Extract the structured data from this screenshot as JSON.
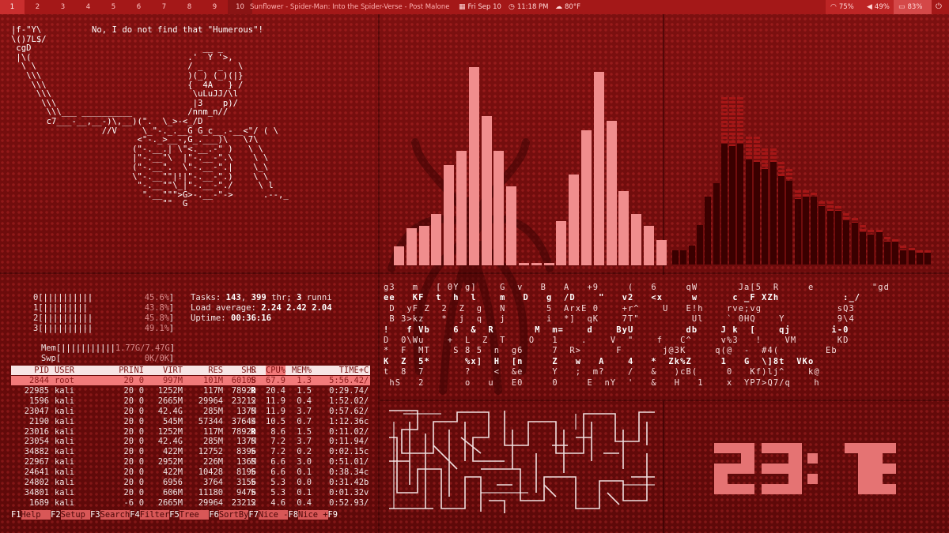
{
  "topbar": {
    "workspaces": [
      "1",
      "2",
      "3",
      "4",
      "5",
      "6",
      "7",
      "8",
      "9",
      "10"
    ],
    "active_workspace": "1",
    "now_playing": "Sunflower - Spider-Man: Into the Spider-Verse - Post Malone",
    "date": "Fri Sep 10",
    "time": "11:18 PM",
    "weather": "80°F",
    "wifi": "75%",
    "volume": "49%",
    "battery": "83%",
    "icons": [
      "calendar-icon",
      "clock-icon",
      "cloud-icon",
      "wifi-icon",
      "volume-icon",
      "battery-icon",
      "power-icon"
    ]
  },
  "ascii": {
    "lines": [
      "|f-\"Y\\          No, I do not find that \"Humerous\"!",
      "\\()7L$/",
      " cgD                                  __ _",
      " |\\(                               .'  Y '>,",
      "  \\ \\                              / _   _   \\",
      "   \\\\\\                             )(_) (_)(|}",
      "    \\\\\\                            {  4A   } /",
      "     \\\\\\                            \\uLuJJ/\\l",
      "      \\\\\\                           |3    p)/",
      "       \\\\\\___ __________           /nnm_n//",
      "       c7___-__,__-)\\,__)(\".  \\_>-<_/D",
      "                  //V     \\_\"-._.__G G_c__.-__<\"/ ( \\",
      "                         <\"-._>__-,G_.___)\\   \\7\\",
      "                        (\"-.__.| \\\"<.__.-\" )   \\ \\",
      "                        |\"-.__\"\\  |\"-.__-\".\\    \\ \\",
      "                        (\"-.__\".  \\\"-.__-\".|    \\_\\",
      "                        \\\"-.__\"\"|!|\"-.__-\".)    \\ \\",
      "                         \"-.__\"\"\\_|\"-.__-\"./     \\ l",
      "                          \".__\"\"\">G>-.__-\"->      .--,_",
      "                              \"\"  G"
    ]
  },
  "htop": {
    "cpus": [
      {
        "label": "0",
        "bar": "||||||||||",
        "pct": "45.6%",
        "fill": 0.456
      },
      {
        "label": "1",
        "bar": "|||||||||",
        "pct": "43.8%",
        "fill": 0.438
      },
      {
        "label": "2",
        "bar": "||||||||||",
        "pct": "45.8%",
        "fill": 0.458
      },
      {
        "label": "3",
        "bar": "||||||||||",
        "pct": "49.1%",
        "fill": 0.491
      }
    ],
    "mem": {
      "label": "Mem",
      "bar": "|||||||||||",
      "value": "1.77G/7.47G"
    },
    "swp": {
      "label": "Swp",
      "bar": "",
      "value": "0K/0K"
    },
    "tasks_text": "Tasks: ",
    "tasks": "143",
    "thr_text": ", ",
    "thr": "399",
    "thr_suffix": " thr; ",
    "running": "3",
    "running_suffix": " runni",
    "load_label": "Load average: ",
    "load": "2.24 2.42 2.04",
    "uptime_label": "Uptime: ",
    "uptime": "00:36:16",
    "columns": [
      "PID",
      "USER",
      "PRI",
      "NI",
      "VIRT",
      "RES",
      "SHR",
      "S",
      "CPU%",
      "MEM%",
      "TIME+",
      "C"
    ],
    "rows": [
      [
        "2844",
        "root",
        "20",
        "0",
        "997M",
        "101M",
        "60108",
        "S",
        "67.9",
        "1.3",
        "5:56.42",
        "/"
      ],
      [
        "22985",
        "kali",
        "20",
        "0",
        "1252M",
        "117M",
        "78920",
        "R",
        "20.4",
        "1.5",
        "0:29.74",
        "/"
      ],
      [
        "1596",
        "kali",
        "20",
        "0",
        "2665M",
        "29964",
        "23212",
        "S",
        "11.9",
        "0.4",
        "1:52.02",
        "/"
      ],
      [
        "23047",
        "kali",
        "20",
        "0",
        "42.4G",
        "285M",
        "137M",
        "S",
        "11.9",
        "3.7",
        "0:57.62",
        "/"
      ],
      [
        "2190",
        "kali",
        "20",
        "0",
        "545M",
        "57344",
        "37644",
        "S",
        "10.5",
        "0.7",
        "1:12.36",
        "c"
      ],
      [
        "23016",
        "kali",
        "20",
        "0",
        "1252M",
        "117M",
        "78920",
        "R",
        "8.6",
        "1.5",
        "0:11.02",
        "/"
      ],
      [
        "23054",
        "kali",
        "20",
        "0",
        "42.4G",
        "285M",
        "137M",
        "S",
        "7.2",
        "3.7",
        "0:11.94",
        "/"
      ],
      [
        "34882",
        "kali",
        "20",
        "0",
        "422M",
        "12752",
        "8396",
        "S",
        "7.2",
        "0.2",
        "0:02.15",
        "c"
      ],
      [
        "22967",
        "kali",
        "20",
        "0",
        "2952M",
        "226M",
        "136M",
        "S",
        "6.6",
        "3.0",
        "0:51.01",
        "/"
      ],
      [
        "24641",
        "kali",
        "20",
        "0",
        "422M",
        "10428",
        "8196",
        "S",
        "6.6",
        "0.1",
        "0:38.34",
        "c"
      ],
      [
        "24802",
        "kali",
        "20",
        "0",
        "6956",
        "3764",
        "3156",
        "S",
        "5.3",
        "0.0",
        "0:31.42",
        "b"
      ],
      [
        "34801",
        "kali",
        "20",
        "0",
        "606M",
        "11180",
        "9476",
        "S",
        "5.3",
        "0.1",
        "0:01.32",
        "v"
      ],
      [
        "1689",
        "kali",
        "-6",
        "0",
        "2665M",
        "29964",
        "23212",
        "S",
        "4.6",
        "0.4",
        "0:52.93",
        "/"
      ]
    ],
    "fkeys": [
      {
        "key": "F1",
        "label": "Help  "
      },
      {
        "key": "F2",
        "label": "Setup "
      },
      {
        "key": "F3",
        "label": "Search"
      },
      {
        "key": "F4",
        "label": "Filter"
      },
      {
        "key": "F5",
        "label": "Tree  "
      },
      {
        "key": "F6",
        "label": "SortBy"
      },
      {
        "key": "F7",
        "label": "Nice -"
      },
      {
        "key": "F8",
        "label": "Nice +"
      },
      {
        "key": "F9",
        "label": ""
      }
    ]
  },
  "visualizer_center": {
    "color": "#f08d8d",
    "levels": [
      0.08,
      0.16,
      0.17,
      0.22,
      0.43,
      0.49,
      0.85,
      0.64,
      0.49,
      0.34,
      0.01,
      0.01,
      0.01,
      0.19,
      0.39,
      0.58,
      0.83,
      0.62,
      0.32,
      0.22,
      0.17,
      0.11
    ]
  },
  "visualizer_right": {
    "color": "#3a0000",
    "levels": [
      0.06,
      0.06,
      0.08,
      0.17,
      0.29,
      0.35,
      0.52,
      0.51,
      0.52,
      0.45,
      0.44,
      0.41,
      0.44,
      0.38,
      0.36,
      0.28,
      0.29,
      0.29,
      0.25,
      0.23,
      0.23,
      0.19,
      0.18,
      0.14,
      0.13,
      0.14,
      0.1,
      0.1,
      0.06,
      0.06,
      0.05,
      0.05
    ],
    "peak_levels": [
      0.06,
      0.06,
      0.08,
      0.17,
      0.29,
      0.35,
      0.72,
      0.72,
      0.72,
      0.55,
      0.55,
      0.5,
      0.5,
      0.44,
      0.41,
      0.32,
      0.32,
      0.31,
      0.27,
      0.27,
      0.25,
      0.22,
      0.2,
      0.17,
      0.15,
      0.15,
      0.12,
      0.11,
      0.08,
      0.07,
      0.06,
      0.06
    ]
  },
  "matrix": {
    "rows": [
      "g3   m   [ 0Y g]    G  v   B   A   +9     (   6     qW       Ja[5  R     e          \"gd",
      "ee   KF  t  h  l    m   D   g  /D    \"   v2   <x     w      c _F XZh           :_/",
      " D  yF Z  2  Z  g   N       5  ArxE 0    +r^    U   E!h    rve;vg             sQ3",
      " B 3>kz   *  j  q   j       i  *]  qK    7T\"         Ul    ` 0HQ    Y         9\\4",
      "!   f Vb    6  &  R       M  m=    d    ByU         db    J k  [    qj       i-0",
      "D  0\\Wu    +  L  Z  T    O   1    .    V  \"    f   C^     v%3   !    VM       KD",
      "*  F  MT    S 8 5  n  g6     7  R>      F       j@3K     q(@  -  #4(        Eb",
      "K  Z  5*      %x]  H  [n     Z   w   A    4   *  Zk%Z     1   G  \\]8t  VKo",
      "t  8  7       ?    <  &e     Y   ;  m?    /   &   )cB(     0   Kf)lj^    k@",
      " hS   2       o   u   E0     0     E  nY  '   &   H   1    x  YP7>Q7/q    h"
    ]
  },
  "clock": {
    "hours": "23",
    "sep": ":",
    "minutes": "18"
  }
}
